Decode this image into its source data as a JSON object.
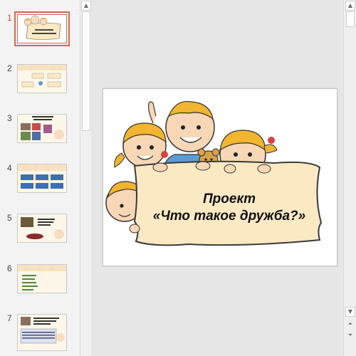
{
  "thumbnails": [
    {
      "number": "1",
      "selected": true
    },
    {
      "number": "2",
      "selected": false
    },
    {
      "number": "3",
      "selected": false
    },
    {
      "number": "4",
      "selected": false
    },
    {
      "number": "5",
      "selected": false
    },
    {
      "number": "6",
      "selected": false
    },
    {
      "number": "7",
      "selected": false
    }
  ],
  "main_slide": {
    "title_line1": "Проект",
    "title_line2": "«Что такое дружба?»"
  },
  "scrollbar": {
    "up_glyph": "▲",
    "down_glyph": "▼",
    "prev_slide_glyph": "⏶",
    "next_slide_glyph": "⏷"
  },
  "colors": {
    "selection_accent": "#d26a4f",
    "banner_fill": "#fbe9c4",
    "banner_stroke": "#3a3a3a"
  }
}
